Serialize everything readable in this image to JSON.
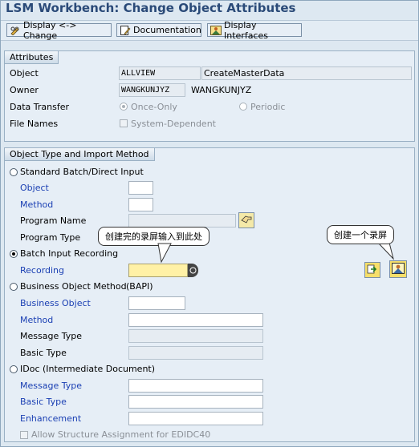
{
  "window": {
    "title": "LSM Workbench: Change Object Attributes"
  },
  "toolbar": {
    "display_change": "Display <-> Change",
    "documentation": "Documentation",
    "display_interfaces": "Display Interfaces"
  },
  "attributes": {
    "group_title": "Attributes",
    "object_label": "Object",
    "object_value": "ALLVIEW",
    "object_desc": "CreateMasterData",
    "owner_label": "Owner",
    "owner_value": "WANGKUNJYZ",
    "owner_desc": "WANGKUNJYZ",
    "data_transfer_label": "Data Transfer",
    "once_only": "Once-Only",
    "periodic": "Periodic",
    "file_names_label": "File Names",
    "system_dependent": "System-Dependent"
  },
  "object_type": {
    "group_title": "Object Type and Import Method",
    "standard_batch": "Standard Batch/Direct Input",
    "std_object": "Object",
    "std_method": "Method",
    "program_name": "Program Name",
    "program_type": "Program Type",
    "batch_input_recording": "Batch Input Recording",
    "recording": "Recording",
    "recording_value": "",
    "bo_method": "Business Object Method",
    "bapi": "(BAPI)",
    "business_object": "Business Object",
    "bapi_method": "Method",
    "message_type": "Message Type",
    "basic_type": "Basic Type",
    "idoc": "IDoc (Intermediate Document)",
    "idoc_message_type": "Message Type",
    "idoc_basic_type": "Basic Type",
    "enhancement": "Enhancement",
    "allow_structure": "Allow Structure Assignment for EDIDC40"
  },
  "callouts": {
    "recording_hint": "创建完的录屏输入到此处",
    "create_hint": "创建一个录屏"
  }
}
